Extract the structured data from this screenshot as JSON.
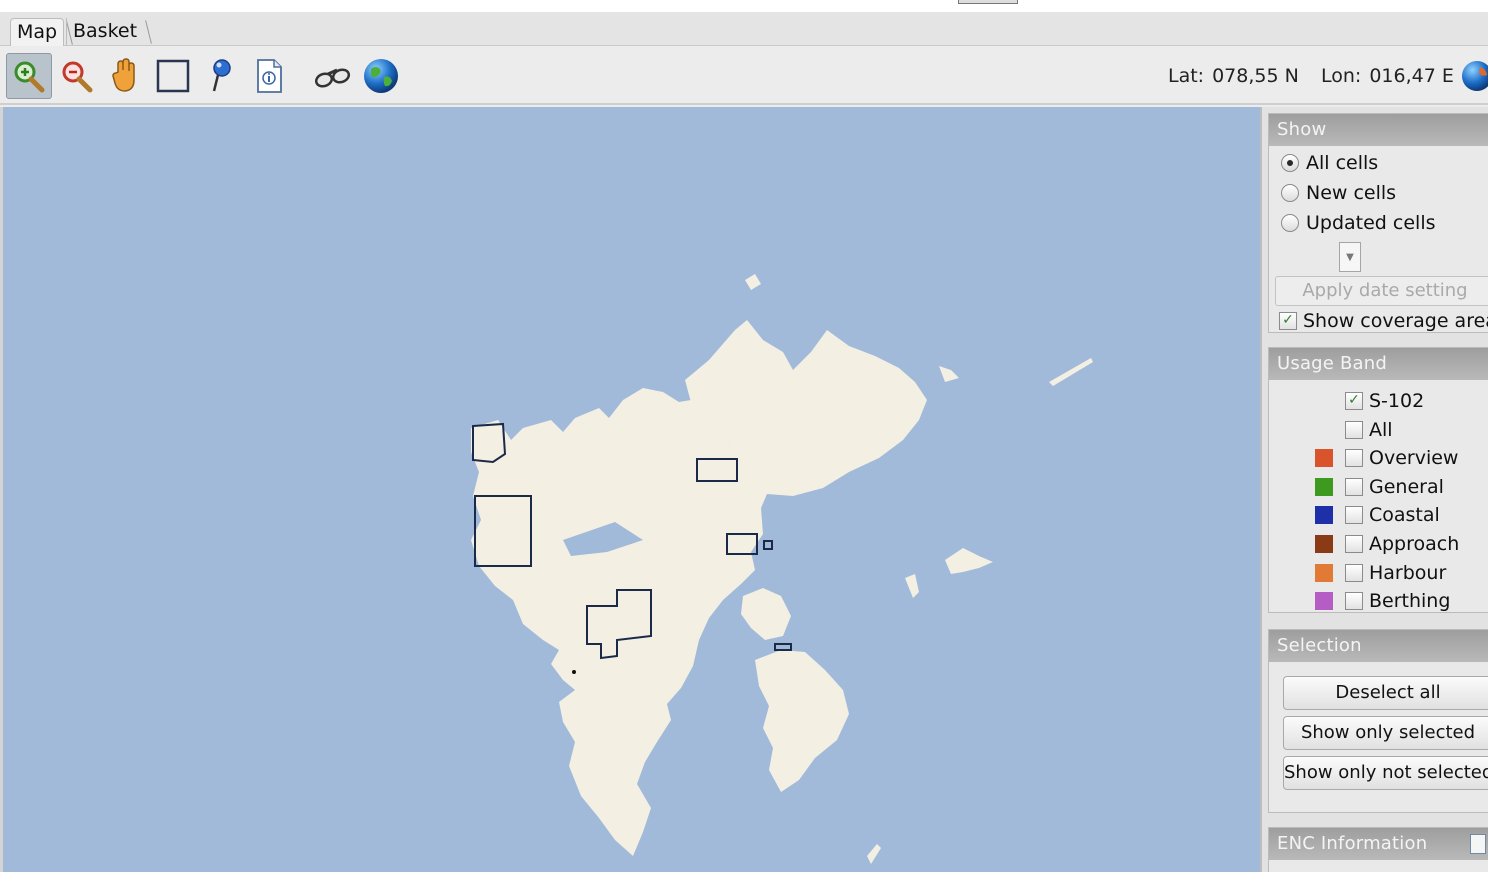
{
  "tabs": [
    {
      "label": "Map",
      "active": true
    },
    {
      "label": "Basket",
      "active": false
    }
  ],
  "toolbar": {
    "tools": [
      "zoom-in-icon",
      "zoom-out-icon",
      "pan-hand-icon",
      "rectangle-select-icon",
      "pin-icon",
      "info-document-icon",
      "binoculars-icon",
      "globe-icon"
    ],
    "lat_label": "Lat:",
    "lat_value": "078,55 N",
    "lon_label": "Lon:",
    "lon_value": "016,47 E"
  },
  "show": {
    "title": "Show",
    "options": [
      {
        "label": "All cells",
        "selected": true
      },
      {
        "label": "New cells",
        "selected": false
      },
      {
        "label": "Updated cells",
        "selected": false
      }
    ],
    "apply_label": "Apply date setting",
    "coverage_label": "Show coverage areas",
    "coverage_checked": true
  },
  "usage_band": {
    "title": "Usage Band",
    "items": [
      {
        "label": "S-102",
        "checked": true,
        "color": ""
      },
      {
        "label": "All",
        "checked": false,
        "color": ""
      },
      {
        "label": "Overview",
        "checked": false,
        "color": "#d9542b"
      },
      {
        "label": "General",
        "checked": false,
        "color": "#3d9a1f"
      },
      {
        "label": "Coastal",
        "checked": false,
        "color": "#1f2fa8"
      },
      {
        "label": "Approach",
        "checked": false,
        "color": "#8a3a16"
      },
      {
        "label": "Harbour",
        "checked": false,
        "color": "#e07a35"
      },
      {
        "label": "Berthing",
        "checked": false,
        "color": "#b65cc5"
      }
    ]
  },
  "selection": {
    "title": "Selection",
    "deselect_all": "Deselect all",
    "show_only_selected": "Show only selected",
    "show_only_not_selected": "Show only not selected"
  },
  "enc_info": {
    "title": "ENC Information"
  },
  "colors": {
    "sea": "#a1bada",
    "land": "#f3efe2",
    "coverage": "#1a2a48"
  }
}
